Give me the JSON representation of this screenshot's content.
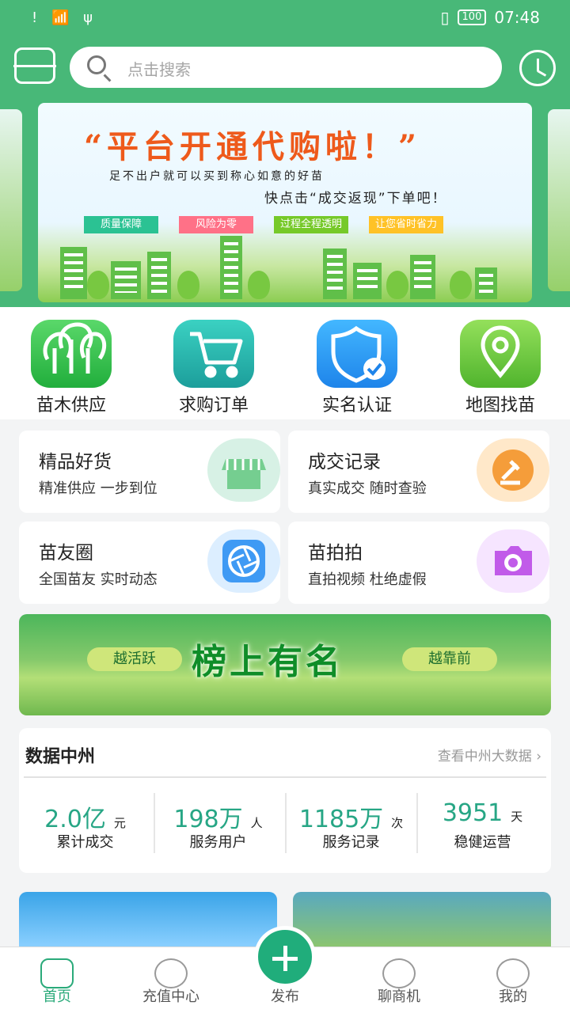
{
  "status": {
    "left": "! 📶 ψ",
    "battery": "100",
    "time": "07:48"
  },
  "search": {
    "placeholder": "点击搜索"
  },
  "banner": {
    "headline": "“平台开通代购啦！”",
    "sub1": "足不出户就可以买到称心如意的好苗",
    "sub2": "快点击“成交返现”下单吧！",
    "tags": [
      "质量保障",
      "风险为零",
      "过程全程透明",
      "让您省时省力"
    ],
    "tag_colors": [
      "#2bc293",
      "#ff7187",
      "#76c929",
      "#ffc227"
    ]
  },
  "quick": [
    {
      "label": "苗木供应"
    },
    {
      "label": "求购订单"
    },
    {
      "label": "实名认证"
    },
    {
      "label": "地图找苗"
    }
  ],
  "cards": [
    {
      "title": "精品好货",
      "desc": "精准供应 一步到位"
    },
    {
      "title": "成交记录",
      "desc": "真实成交 随时查验"
    },
    {
      "title": "苗友圈",
      "desc": "全国苗友 实时动态"
    },
    {
      "title": "苗拍拍",
      "desc": "直拍视频 杜绝虚假"
    }
  ],
  "rank": {
    "left": "越活跃",
    "main": "榜上有名",
    "right": "越靠前"
  },
  "data": {
    "title": "数据中州",
    "more": "查看中州大数据 ›",
    "stats": [
      {
        "num": "2.0亿",
        "unit": "元",
        "label": "累计成交"
      },
      {
        "num": "198万",
        "unit": "人",
        "label": "服务用户"
      },
      {
        "num": "1185万",
        "unit": "次",
        "label": "服务记录"
      },
      {
        "num": "3951",
        "unit": "天",
        "label": "稳健运营"
      }
    ]
  },
  "nav": [
    "首页",
    "充值中心",
    "发布",
    "聊商机",
    "我的"
  ]
}
